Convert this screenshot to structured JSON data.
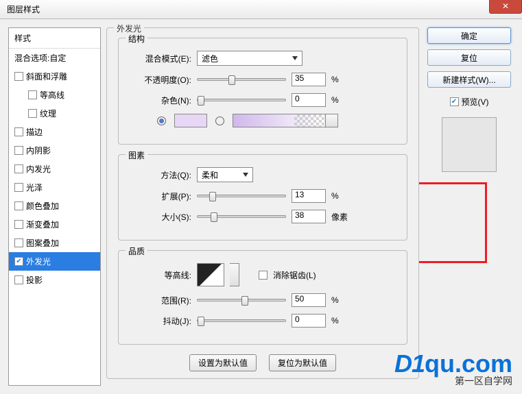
{
  "window": {
    "title": "图层样式"
  },
  "sidebar": {
    "header": "样式",
    "blending_options": "混合选项:自定",
    "items": [
      {
        "label": "斜面和浮雕",
        "checked": false,
        "sub": false
      },
      {
        "label": "等高线",
        "checked": false,
        "sub": true
      },
      {
        "label": "纹理",
        "checked": false,
        "sub": true
      },
      {
        "label": "描边",
        "checked": false,
        "sub": false
      },
      {
        "label": "内阴影",
        "checked": false,
        "sub": false
      },
      {
        "label": "内发光",
        "checked": false,
        "sub": false
      },
      {
        "label": "光泽",
        "checked": false,
        "sub": false
      },
      {
        "label": "颜色叠加",
        "checked": false,
        "sub": false
      },
      {
        "label": "渐变叠加",
        "checked": false,
        "sub": false
      },
      {
        "label": "图案叠加",
        "checked": false,
        "sub": false
      },
      {
        "label": "外发光",
        "checked": true,
        "sub": false,
        "active": true
      },
      {
        "label": "投影",
        "checked": false,
        "sub": false
      }
    ]
  },
  "panel": {
    "title": "外发光",
    "structure": {
      "legend": "结构",
      "blend_mode_label": "混合模式(E):",
      "blend_mode_value": "滤色",
      "opacity_label": "不透明度(O):",
      "opacity_value": "35",
      "opacity_unit": "%",
      "noise_label": "杂色(N):",
      "noise_value": "0",
      "noise_unit": "%"
    },
    "elements": {
      "legend": "图素",
      "method_label": "方法(Q):",
      "method_value": "柔和",
      "spread_label": "扩展(P):",
      "spread_value": "13",
      "spread_unit": "%",
      "size_label": "大小(S):",
      "size_value": "38",
      "size_unit": "像素"
    },
    "quality": {
      "legend": "品质",
      "contour_label": "等高线:",
      "antialias_label": "消除锯齿(L)",
      "range_label": "范围(R):",
      "range_value": "50",
      "range_unit": "%",
      "jitter_label": "抖动(J):",
      "jitter_value": "0",
      "jitter_unit": "%"
    },
    "footer": {
      "make_default": "设置为默认值",
      "reset_default": "复位为默认值"
    }
  },
  "right": {
    "ok": "确定",
    "reset": "复位",
    "new_style": "新建样式(W)...",
    "preview_label": "预览(V)",
    "preview_checked": true
  },
  "watermark": {
    "main": "D1",
    "domain": "qu.com",
    "sub": "第一区自学网"
  }
}
